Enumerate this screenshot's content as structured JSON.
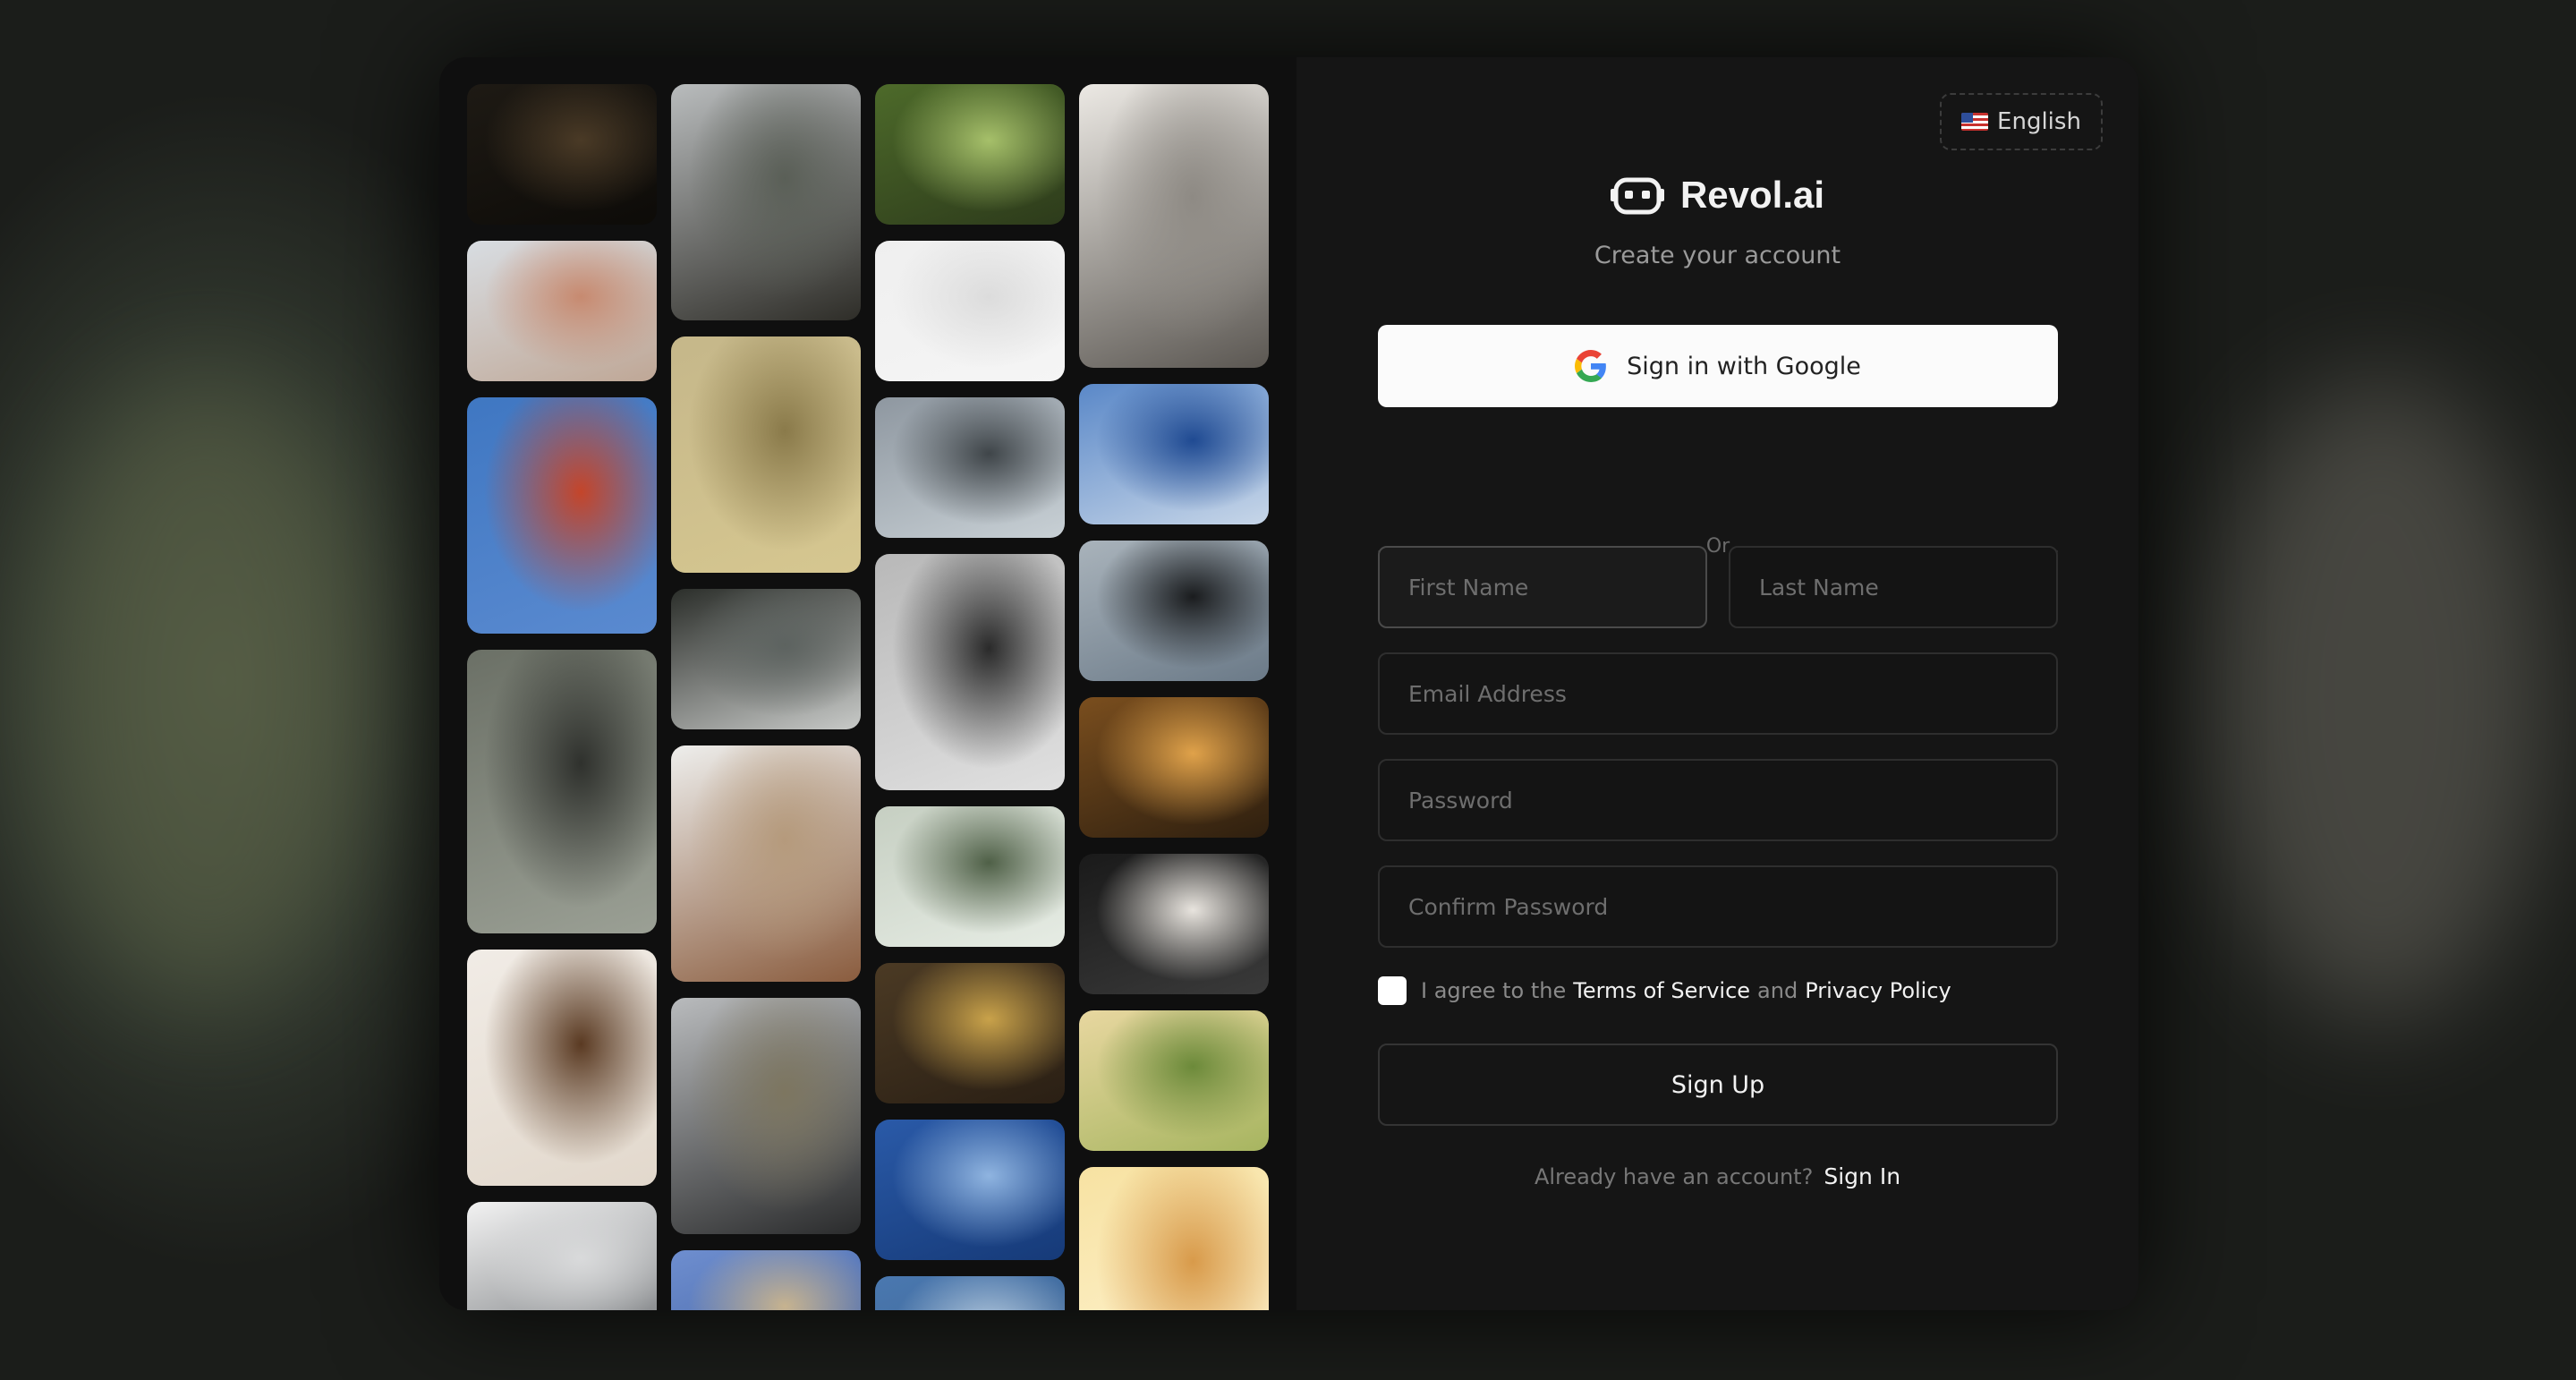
{
  "language": {
    "flag_icon": "us-flag-icon",
    "label": "English"
  },
  "brand": {
    "name": "Revol.ai",
    "subtitle": "Create your account"
  },
  "google": {
    "label": "Sign in with Google"
  },
  "divider": {
    "label": "Or"
  },
  "form": {
    "first_name": {
      "placeholder": "First Name",
      "value": ""
    },
    "last_name": {
      "placeholder": "Last Name",
      "value": ""
    },
    "email": {
      "placeholder": "Email Address",
      "value": ""
    },
    "password": {
      "placeholder": "Password",
      "value": ""
    },
    "confirm_password": {
      "placeholder": "Confirm Password",
      "value": ""
    }
  },
  "agreement": {
    "prefix": "I agree to the",
    "terms": "Terms of Service",
    "and": "and",
    "privacy": "Privacy Policy"
  },
  "signup_button": "Sign Up",
  "signin_prompt": {
    "text": "Already have an account?",
    "link": "Sign In"
  },
  "gallery": [
    [
      {
        "desc": "dark forest",
        "colors": [
          "#1e1a14",
          "#4a3a26",
          "#0d0b08"
        ]
      },
      {
        "desc": "woman reading on beach",
        "colors": [
          "#d8dde2",
          "#c78a70",
          "#bfa796"
        ]
      },
      {
        "desc": "golden gate bridge",
        "colors": [
          "#3f77c2",
          "#c4452a",
          "#5a8ad0"
        ]
      },
      {
        "desc": "e-reader in hand",
        "colors": [
          "#6b7066",
          "#2f312d",
          "#9ba095"
        ]
      },
      {
        "desc": "coffee beans",
        "colors": [
          "#f1ece6",
          "#5a3a22",
          "#e2d8cc"
        ]
      },
      {
        "desc": "snowy peak",
        "colors": [
          "#f2f2f2",
          "#d9dadb",
          "#7a7d80"
        ]
      }
    ],
    [
      {
        "desc": "foggy pine forest",
        "colors": [
          "#b9bcbd",
          "#5a5f57",
          "#2e2d28"
        ]
      },
      {
        "desc": "hazy city skyline",
        "colors": [
          "#c5b78a",
          "#8a7a4a",
          "#d6c790"
        ]
      },
      {
        "desc": "snowy forest floor",
        "colors": [
          "#2b2e2a",
          "#5d6360",
          "#c8cac8"
        ]
      },
      {
        "desc": "calm lake",
        "colors": [
          "#eeeeec",
          "#b59a7c",
          "#8a5c3e"
        ]
      },
      {
        "desc": "coastal cliffs",
        "colors": [
          "#b9bbbd",
          "#7d7660",
          "#2a2b2c"
        ]
      },
      {
        "desc": "architecture ceiling",
        "colors": [
          "#6e8ecf",
          "#c7b38f",
          "#3f5e9e"
        ]
      }
    ],
    [
      {
        "desc": "tall trees from below",
        "colors": [
          "#4d6a2a",
          "#a6c06a",
          "#2d3b1b"
        ]
      },
      {
        "desc": "white mist",
        "colors": [
          "#efefef",
          "#dcdcdc",
          "#f5f5f5"
        ]
      },
      {
        "desc": "architectural model",
        "colors": [
          "#8e97a0",
          "#3f4549",
          "#c8d0d5"
        ]
      },
      {
        "desc": "abstract curves",
        "colors": [
          "#b8b8b8",
          "#2a2a2a",
          "#e0e0e0"
        ]
      },
      {
        "desc": "balcony plants",
        "colors": [
          "#c6cfc2",
          "#4f6047",
          "#e6ece4"
        ]
      },
      {
        "desc": "wooden window",
        "colors": [
          "#4b3a24",
          "#c9a24a",
          "#2a1f14"
        ]
      },
      {
        "desc": "ocean waves",
        "colors": [
          "#2a5aa8",
          "#8fb4e0",
          "#163a78"
        ]
      },
      {
        "desc": "blue sky",
        "colors": [
          "#4a78b0",
          "#b9cde0",
          "#3a5f8a"
        ]
      }
    ],
    [
      {
        "desc": "laptop on desk",
        "colors": [
          "#ece9e4",
          "#8e8a84",
          "#5b5752"
        ]
      },
      {
        "desc": "island in sea",
        "colors": [
          "#5a88c8",
          "#1f4a92",
          "#c7d6e8"
        ]
      },
      {
        "desc": "man by foggy lake",
        "colors": [
          "#a9b3bb",
          "#1a1c1e",
          "#6b7a88"
        ]
      },
      {
        "desc": "golden grass",
        "colors": [
          "#7a4e1e",
          "#e0a24a",
          "#2e1f0f"
        ]
      },
      {
        "desc": "box by window",
        "colors": [
          "#1a1a1a",
          "#e8e4de",
          "#3a3a3a"
        ]
      },
      {
        "desc": "woman in field",
        "colors": [
          "#e8d7a0",
          "#6c8a3a",
          "#a7b560"
        ]
      },
      {
        "desc": "sunlit portrait",
        "colors": [
          "#f7e2a2",
          "#d89a4a",
          "#fff5d6"
        ]
      }
    ]
  ]
}
